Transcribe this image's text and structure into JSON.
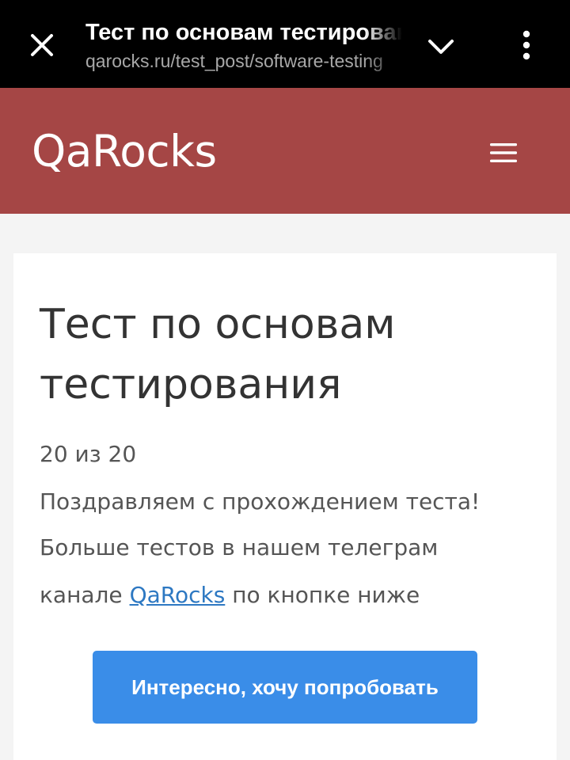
{
  "browser": {
    "tab_title": "Тест по основам тестирования",
    "url": "qarocks.ru/test_post/software-testing"
  },
  "site": {
    "logo": "QaRocks"
  },
  "post": {
    "title": "Тест по основам тестирования",
    "score": "20 из 20",
    "congrats": "Поздравляем с прохождением теста!",
    "more_text": "Больше тестов в нашем телеграм",
    "channel_prefix": "канале ",
    "channel_link": "QaRocks",
    "channel_suffix": " по кнопке ниже",
    "cta_label": "Интересно, хочу попробовать"
  },
  "colors": {
    "browser_bar": "#000000",
    "header": "#a54645",
    "page_bg": "#f4f4f4",
    "button": "#3a8de8",
    "link": "#2d78c2"
  }
}
